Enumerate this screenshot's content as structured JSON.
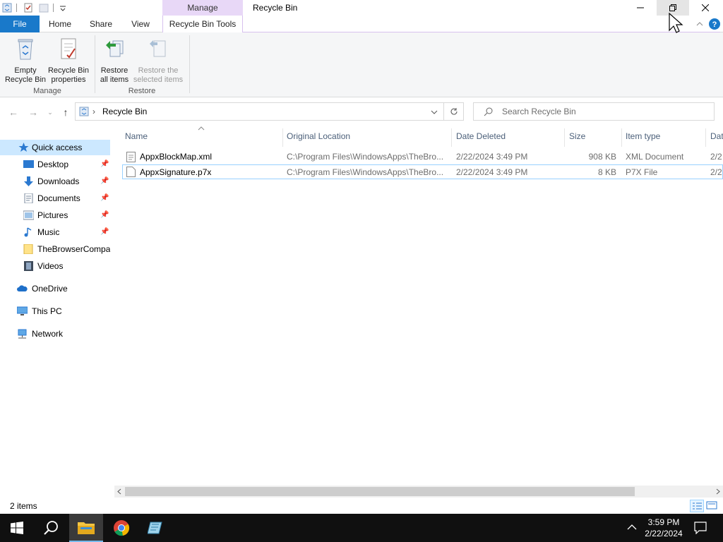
{
  "titlebar": {
    "context_tab": "Manage",
    "title": "Recycle Bin"
  },
  "tabs": {
    "file": "File",
    "home": "Home",
    "share": "Share",
    "view": "View",
    "tools": "Recycle Bin Tools"
  },
  "ribbon": {
    "empty_recycle_bin": "Empty\nRecycle Bin",
    "recycle_bin_properties": "Recycle Bin\nproperties",
    "restore_all": "Restore\nall items",
    "restore_selected": "Restore the\nselected items",
    "group_manage": "Manage",
    "group_restore": "Restore"
  },
  "address": {
    "location": "Recycle Bin",
    "search_placeholder": "Search Recycle Bin"
  },
  "sidebar": {
    "quick_access": "Quick access",
    "items": [
      {
        "label": "Desktop",
        "icon": "desktop-icon",
        "pinned": true
      },
      {
        "label": "Downloads",
        "icon": "downloads-icon",
        "pinned": true
      },
      {
        "label": "Documents",
        "icon": "documents-icon",
        "pinned": true
      },
      {
        "label": "Pictures",
        "icon": "pictures-icon",
        "pinned": true
      },
      {
        "label": "Music",
        "icon": "music-icon",
        "pinned": true
      },
      {
        "label": "TheBrowserCompar",
        "icon": "folder-icon",
        "pinned": false
      },
      {
        "label": "Videos",
        "icon": "videos-icon",
        "pinned": false
      }
    ],
    "onedrive": "OneDrive",
    "this_pc": "This PC",
    "network": "Network"
  },
  "columns": {
    "name": "Name",
    "original_location": "Original Location",
    "date_deleted": "Date Deleted",
    "size": "Size",
    "item_type": "Item type",
    "date_modified": "Dat"
  },
  "files": [
    {
      "name": "AppxBlockMap.xml",
      "location": "C:\\Program Files\\WindowsApps\\TheBro...",
      "date_deleted": "2/22/2024 3:49 PM",
      "size": "908 KB",
      "type": "XML Document",
      "modified": "2/2"
    },
    {
      "name": "AppxSignature.p7x",
      "location": "C:\\Program Files\\WindowsApps\\TheBro...",
      "date_deleted": "2/22/2024 3:49 PM",
      "size": "8 KB",
      "type": "P7X File",
      "modified": "2/2"
    }
  ],
  "status": {
    "item_count": "2 items"
  },
  "taskbar": {
    "time": "3:59 PM",
    "date": "2/22/2024"
  },
  "colors": {
    "file_tab": "#1979ca",
    "context_tab": "#e8d8f7",
    "selected_nav": "#cce8ff",
    "taskbar": "#101010"
  }
}
